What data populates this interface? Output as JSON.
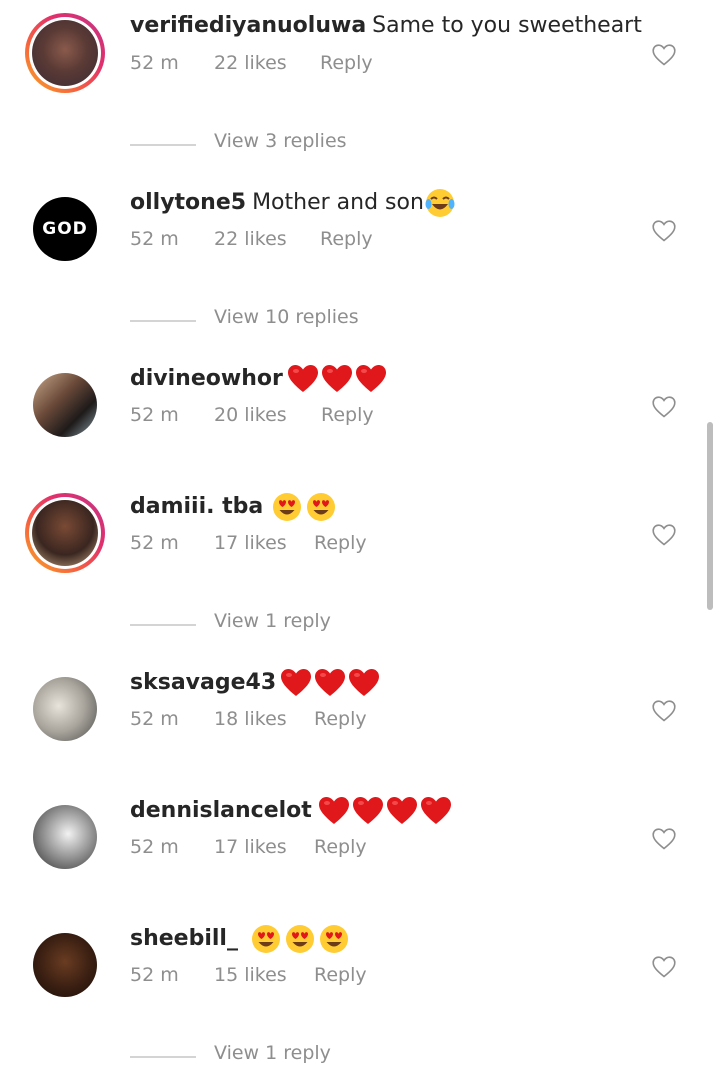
{
  "comments": [
    {
      "username": "verifiediyanuoluwa",
      "text": "Same to you sweetheart",
      "emojis": "",
      "time": "52 m",
      "likes": "22 likes",
      "reply": "Reply",
      "view_replies": "View 3 replies"
    },
    {
      "username": "ollytone5",
      "text": "Mother and son",
      "emojis": "laughing-crying",
      "time": "52 m",
      "likes": "22 likes",
      "reply": "Reply",
      "view_replies": "View 10 replies",
      "avatar_text": "GOD"
    },
    {
      "username": "divineowhor",
      "text": "",
      "emojis": "3 red hearts",
      "time": "52 m",
      "likes": "20 likes",
      "reply": "Reply"
    },
    {
      "username": "damiii. tba",
      "text": "",
      "emojis": "2 heart-eyes",
      "time": "52 m",
      "likes": "17 likes",
      "reply": "Reply",
      "view_replies": "View 1 reply"
    },
    {
      "username": "sksavage43",
      "text": "",
      "emojis": "3 red hearts",
      "time": "52 m",
      "likes": "18 likes",
      "reply": "Reply"
    },
    {
      "username": "dennislancelot",
      "text": "",
      "emojis": "4 red hearts",
      "time": "52 m",
      "likes": "17 likes",
      "reply": "Reply"
    },
    {
      "username": "sheebill_",
      "text": "",
      "emojis": "3 heart-eyes",
      "time": "52 m",
      "likes": "15 likes",
      "reply": "Reply",
      "view_replies": "View 1 reply"
    }
  ],
  "colors": {
    "text": "#262626",
    "muted": "#8e8e8e",
    "heart_red": "#e0181b"
  },
  "icons": [
    "heart-outline-icon",
    "red-heart-emoji",
    "heart-eyes-emoji",
    "laughing-crying-emoji"
  ]
}
